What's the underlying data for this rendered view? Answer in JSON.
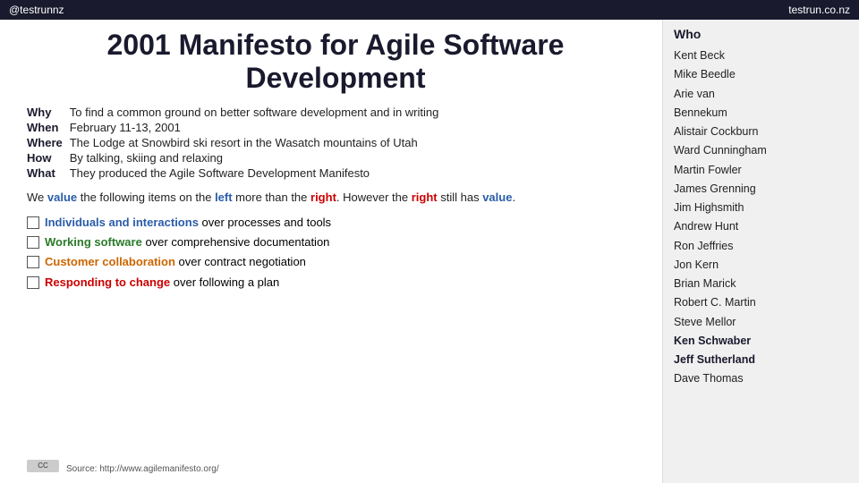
{
  "topbar": {
    "left": "@testrunnz",
    "right": "testrun.co.nz"
  },
  "title": {
    "line1": "2001 Manifesto for Agile Software",
    "line2": "Development"
  },
  "facts": [
    {
      "label": "Why",
      "value": "To find a common ground on better software development and in writing"
    },
    {
      "label": "When",
      "value": "February 11-13, 2001"
    },
    {
      "label": "Where",
      "value": "The Lodge at Snowbird ski resort in the Wasatch mountains of Utah"
    },
    {
      "label": "How",
      "value": "By talking, skiing and relaxing"
    },
    {
      "label": "What",
      "value": "They produced the Agile Software Development Manifesto"
    }
  ],
  "value_statement": {
    "prefix": "We ",
    "value_word": "value",
    "middle": " the following items on the ",
    "left_word": "left",
    "more": " more than the ",
    "right_word": "right",
    "period": ". However the ",
    "right_word2": "right",
    "suffix": " still has ",
    "value_word2": "value",
    "end": "."
  },
  "manifesto_items": [
    {
      "highlight": "Individuals and interactions",
      "rest": " over processes and tools",
      "color": "blue"
    },
    {
      "highlight": "Working software",
      "rest": " over comprehensive documentation",
      "color": "green"
    },
    {
      "highlight": "Customer collaboration",
      "rest": " over contract negotiation",
      "color": "orange"
    },
    {
      "highlight": "Responding to change",
      "rest": " over following a plan",
      "color": "red"
    }
  ],
  "source": {
    "label": "Source:",
    "url": "http://www.agilemanifesto.org/"
  },
  "who": {
    "title": "Who",
    "names": [
      {
        "name": "Kent Beck",
        "bold": false
      },
      {
        "name": "Mike Beedle",
        "bold": false
      },
      {
        "name": "Arie van",
        "bold": false
      },
      {
        "name": "Bennekum",
        "bold": false
      },
      {
        "name": "Alistair Cockburn",
        "bold": false
      },
      {
        "name": "Ward Cunningham",
        "bold": false
      },
      {
        "name": "Martin Fowler",
        "bold": false
      },
      {
        "name": "James Grenning",
        "bold": false
      },
      {
        "name": "Jim Highsmith",
        "bold": false
      },
      {
        "name": "Andrew Hunt",
        "bold": false
      },
      {
        "name": "Ron Jeffries",
        "bold": false
      },
      {
        "name": "Jon Kern",
        "bold": false
      },
      {
        "name": "Brian Marick",
        "bold": false
      },
      {
        "name": "Robert C. Martin",
        "bold": false
      },
      {
        "name": "Steve Mellor",
        "bold": false
      },
      {
        "name": "Ken Schwaber",
        "bold": true
      },
      {
        "name": "Jeff Sutherland",
        "bold": true
      },
      {
        "name": "Dave Thomas",
        "bold": false
      }
    ]
  }
}
